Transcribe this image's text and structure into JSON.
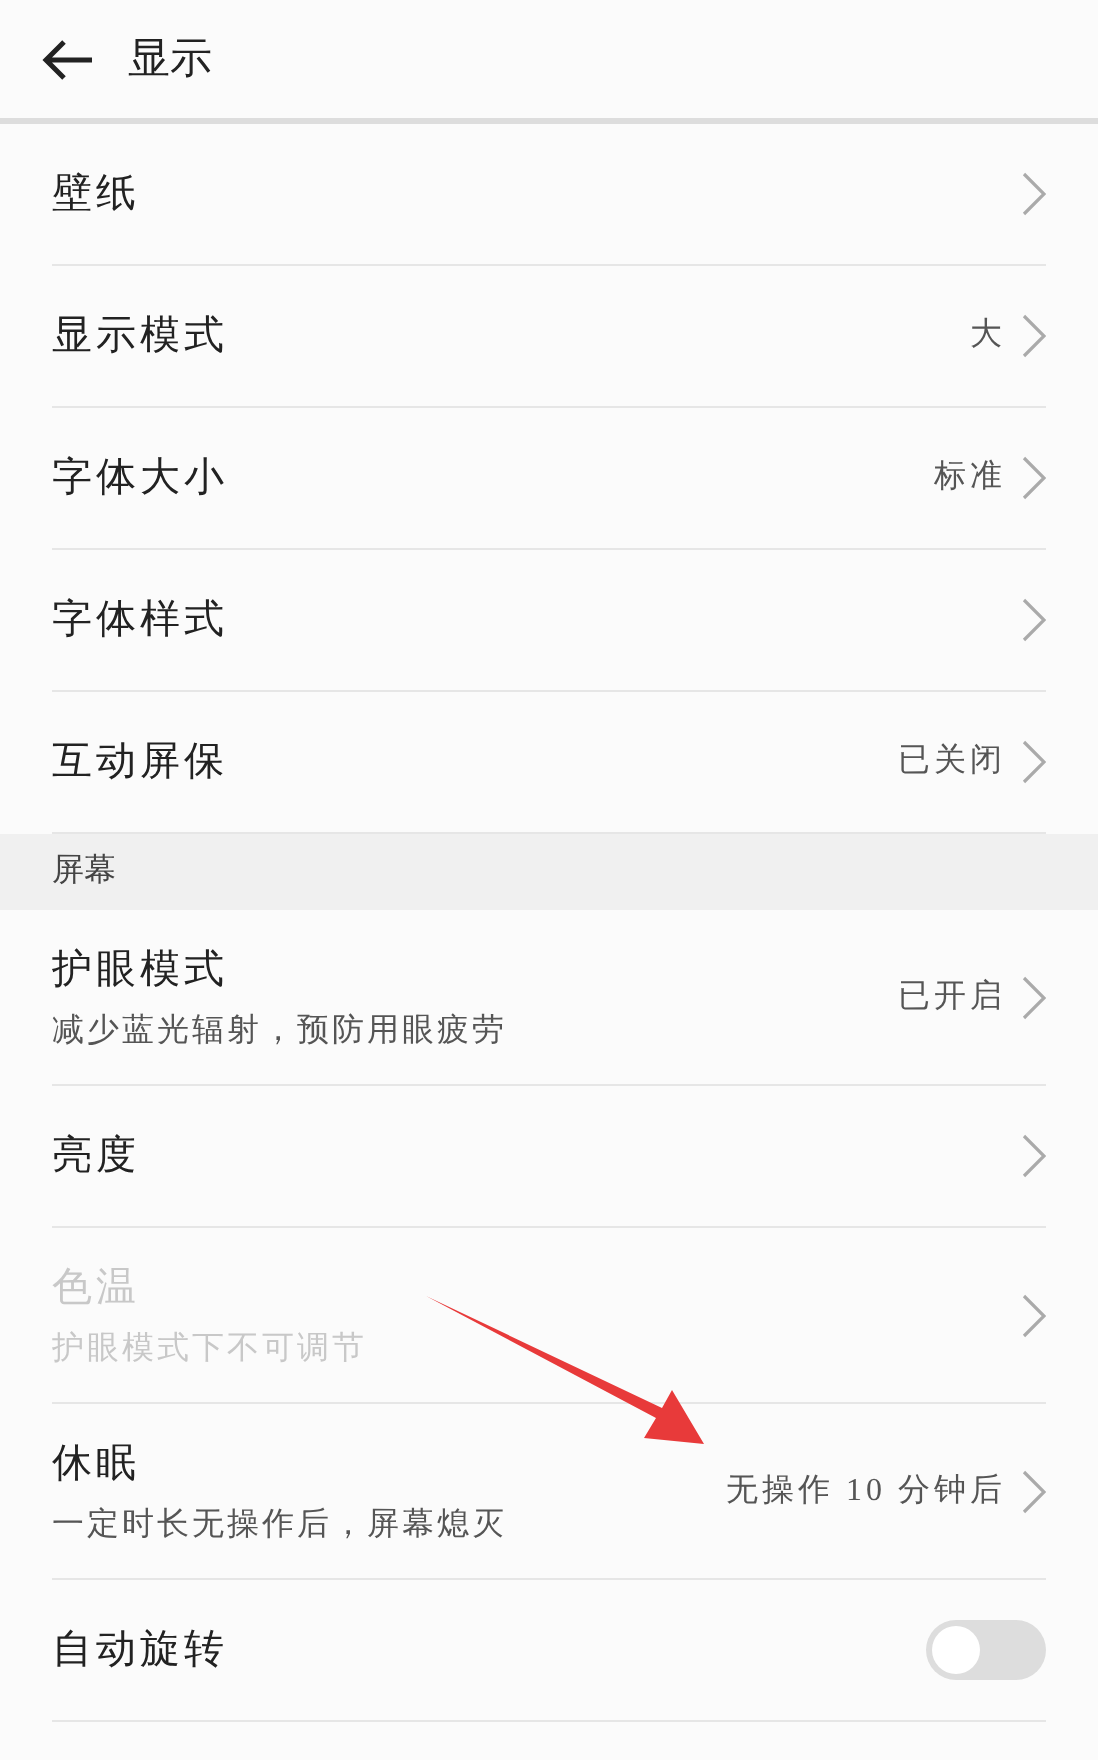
{
  "header": {
    "title": "显示"
  },
  "groups": [
    {
      "items": [
        {
          "kind": "link",
          "title": "壁纸",
          "disabled": false
        },
        {
          "kind": "link",
          "title": "显示模式",
          "value": "大",
          "disabled": false
        },
        {
          "kind": "link",
          "title": "字体大小",
          "value": "标准",
          "disabled": false
        },
        {
          "kind": "link",
          "title": "字体样式",
          "disabled": false
        },
        {
          "kind": "link",
          "title": "互动屏保",
          "value": "已关闭",
          "disabled": false
        }
      ]
    },
    {
      "heading": "屏幕",
      "items": [
        {
          "kind": "link",
          "title": "护眼模式",
          "subtitle": "减少蓝光辐射，预防用眼疲劳",
          "value": "已开启",
          "disabled": false
        },
        {
          "kind": "link",
          "title": "亮度",
          "disabled": false
        },
        {
          "kind": "link",
          "title": "色温",
          "subtitle": "护眼模式下不可调节",
          "disabled": true
        },
        {
          "kind": "link",
          "title": "休眠",
          "subtitle": "一定时长无操作后，屏幕熄灭",
          "value": "无操作 10 分钟后",
          "disabled": false
        },
        {
          "kind": "switch",
          "title": "自动旋转",
          "on": false,
          "disabled": false
        }
      ]
    }
  ]
}
